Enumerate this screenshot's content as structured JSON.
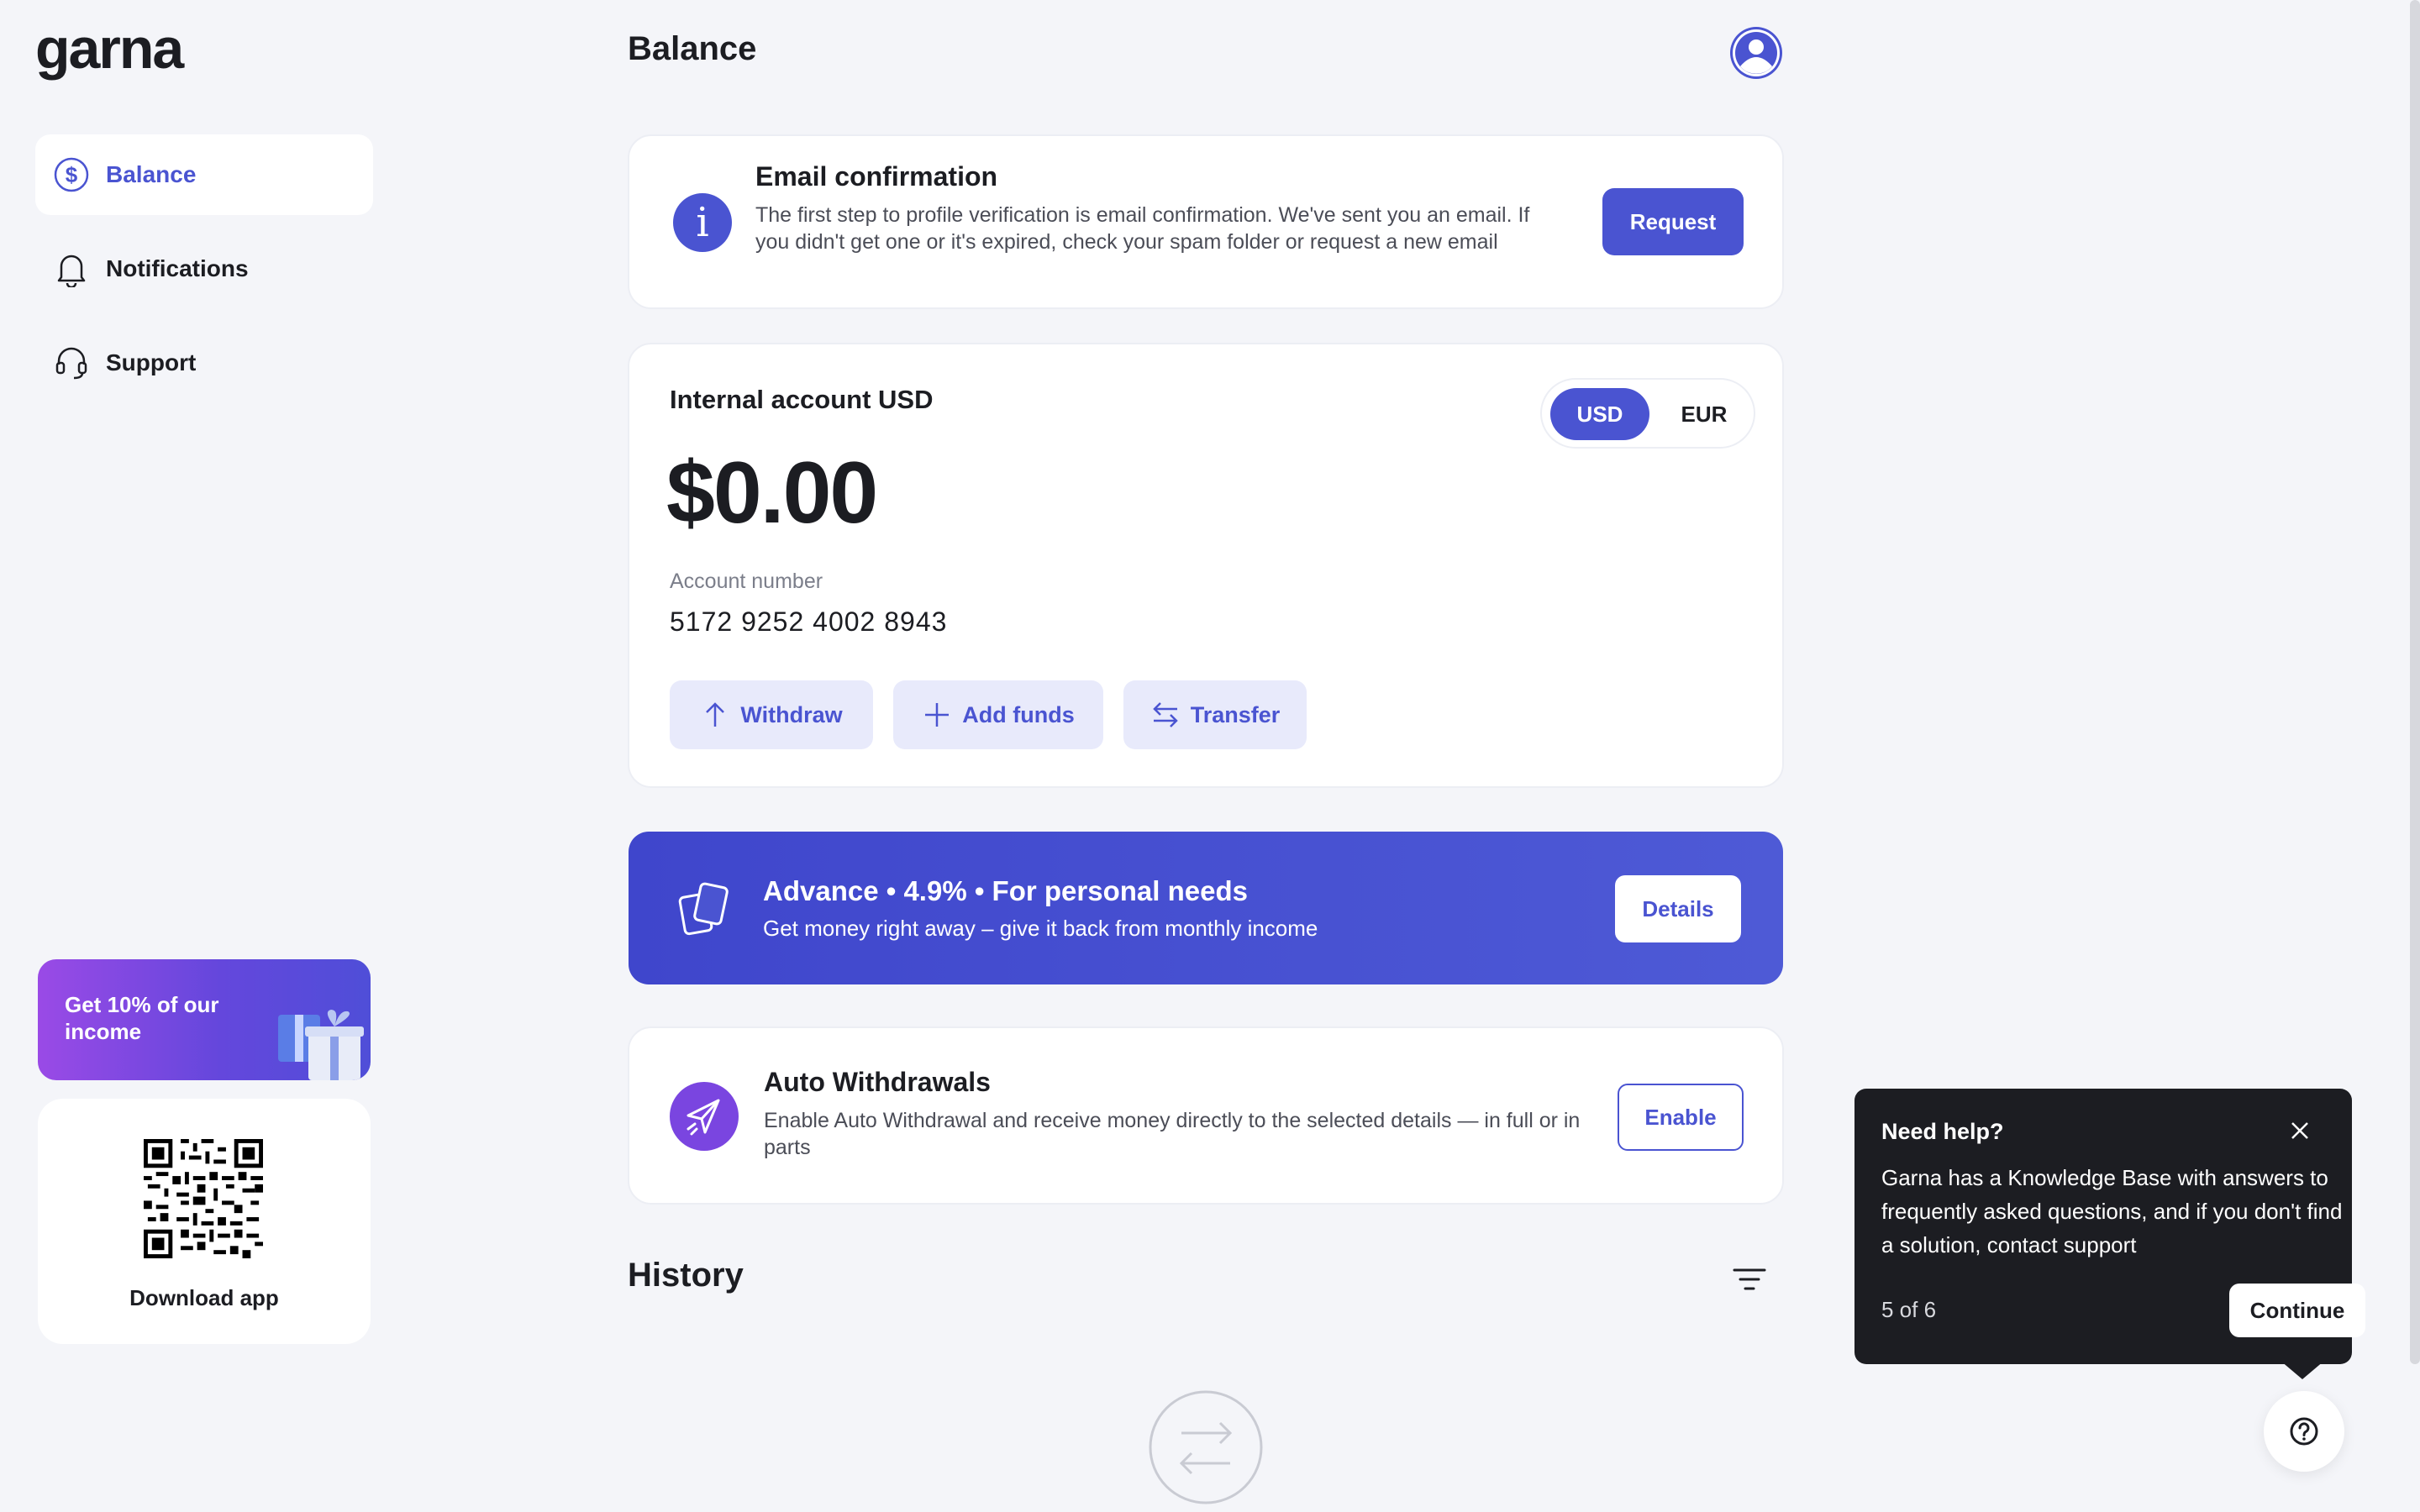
{
  "brand": {
    "logo": "garna",
    "accent": "#4a54d1"
  },
  "sidebar": {
    "items": [
      {
        "label": "Balance",
        "icon": "dollar-circle-icon",
        "active": true
      },
      {
        "label": "Notifications",
        "icon": "bell-icon",
        "active": false
      },
      {
        "label": "Support",
        "icon": "headset-icon",
        "active": false
      }
    ],
    "promo": {
      "text": "Get 10% of our income",
      "icon": "gift-icon"
    },
    "download": {
      "label": "Download app",
      "icon": "qr-code-icon"
    }
  },
  "header": {
    "title": "Balance",
    "avatar_icon": "user-avatar-icon"
  },
  "email_card": {
    "title": "Email confirmation",
    "text": "The first step to profile verification is email confirmation. We've sent you an email. If you didn't get one or it's expired, check your spam folder or request a new email",
    "button": "Request",
    "icon": "info-icon"
  },
  "account_card": {
    "title": "Internal account USD",
    "currencies": [
      "USD",
      "EUR"
    ],
    "selected_currency": "USD",
    "balance": "$0.00",
    "account_label": "Account number",
    "account_number": "5172 9252 4002 8943",
    "actions": [
      {
        "label": "Withdraw",
        "icon": "arrow-up-icon"
      },
      {
        "label": "Add funds",
        "icon": "plus-icon"
      },
      {
        "label": "Transfer",
        "icon": "transfer-arrows-icon"
      }
    ]
  },
  "advance_card": {
    "title": "Advance • 4.9% • For personal needs",
    "subtitle": "Get money right away – give it back from monthly income",
    "button": "Details",
    "icon": "cards-icon"
  },
  "auto_withdrawals": {
    "title": "Auto Withdrawals",
    "text": "Enable Auto Withdrawal and receive money directly to the selected details — in full or in parts",
    "button": "Enable",
    "icon": "paper-plane-icon"
  },
  "history": {
    "title": "History",
    "filter_icon": "filter-icon",
    "empty_icon": "transfer-circle-icon"
  },
  "help_tooltip": {
    "title": "Need help?",
    "text": "Garna has a Knowledge Base with answers to frequently asked questions, and if you don't find a solution, contact support",
    "step": "5 of 6",
    "button": "Continue",
    "close_icon": "close-icon",
    "help_icon": "question-circle-icon"
  }
}
